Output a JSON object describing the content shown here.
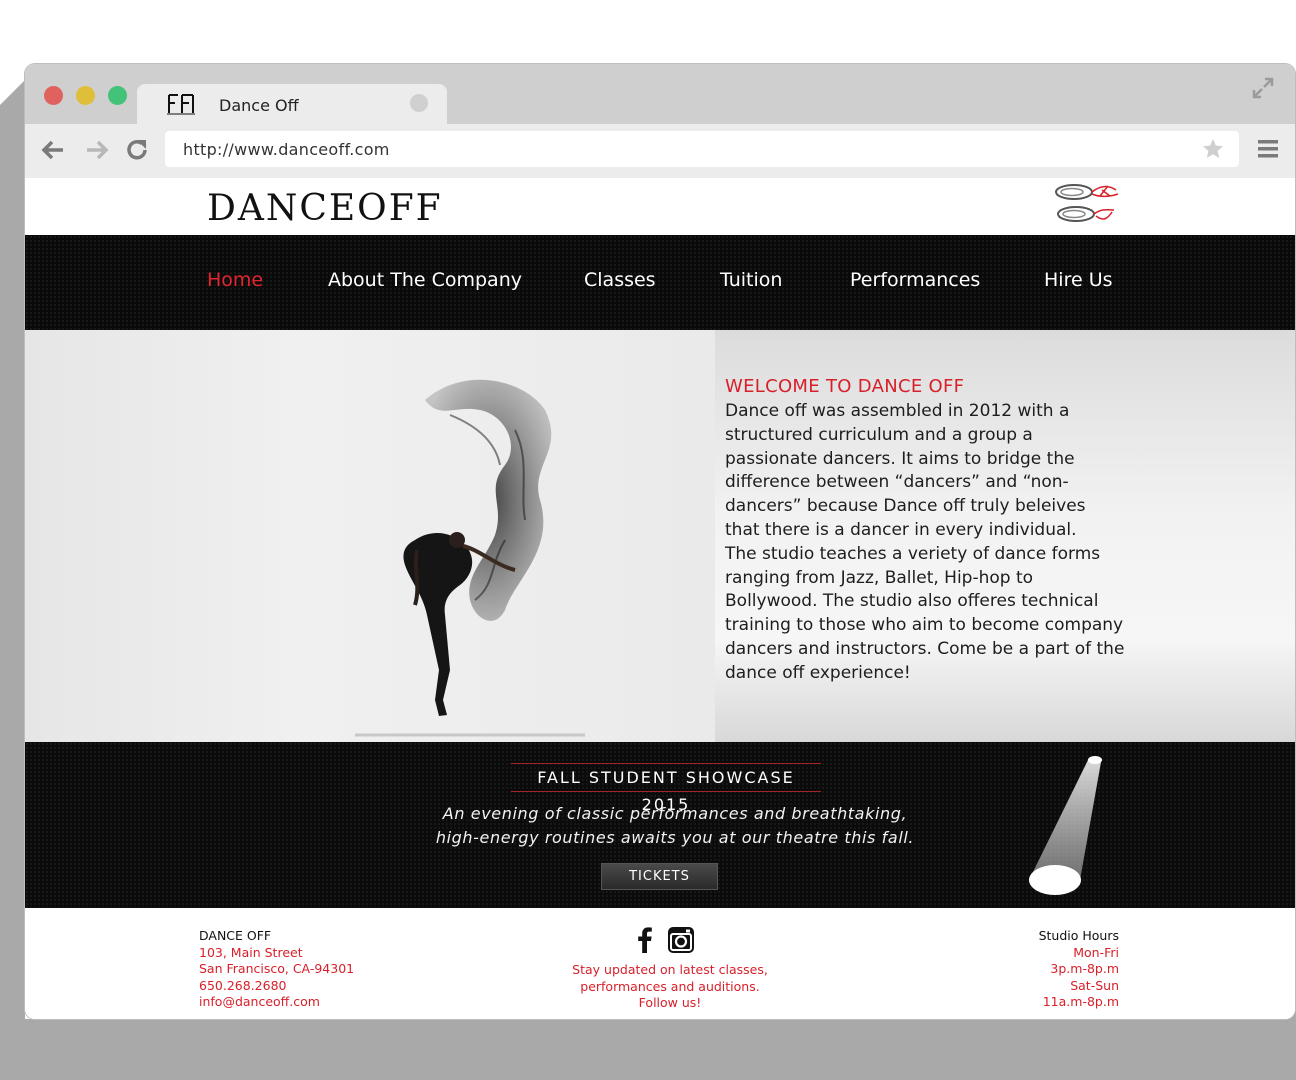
{
  "browser": {
    "tab_title": "Dance Off",
    "url": "http://www.danceoff.com"
  },
  "site": {
    "brand": "DANCEOFF",
    "nav": [
      {
        "label": "Home",
        "active": true
      },
      {
        "label": "About The Company"
      },
      {
        "label": "Classes"
      },
      {
        "label": "Tuition"
      },
      {
        "label": "Performances"
      },
      {
        "label": "Hire Us"
      }
    ],
    "welcome": {
      "title": "WELCOME TO DANCE OFF",
      "text": "Dance off was assembled in 2012 with a structured curriculum and a group a passionate dancers. It aims to bridge the difference between “dancers” and “non-dancers” because Dance off truly beleives that there is a dancer in every individual.\nThe studio teaches a veriety of dance forms ranging from Jazz, Ballet, Hip-hop to Bollywood. The studio also offeres technical training to those who aim to become company dancers and instructors. Come be a part of the dance off experience!"
    },
    "showcase": {
      "title": "FALL STUDENT SHOWCASE 2015",
      "text": "An evening of classic performances and breathtaking, high-energy routines awaits you at our theatre this fall.",
      "button": "TICKETS"
    },
    "footer": {
      "left": {
        "name": "DANCE OFF",
        "address1": "103, Main Street",
        "address2": "San Francisco, CA-94301",
        "phone": "650.268.2680",
        "email": "info@danceoff.com"
      },
      "center": {
        "line1": "Stay updated on latest classes,",
        "line2": "performances and auditions.",
        "line3": "Follow us!"
      },
      "right": {
        "title": "Studio Hours",
        "days1": "Mon-Fri",
        "hours1": "3p.m-8p.m",
        "days2": "Sat-Sun",
        "hours2": "11a.m-8p.m"
      }
    },
    "colors": {
      "accent": "#d8202a",
      "nav_bg": "#0a0a0a"
    }
  }
}
